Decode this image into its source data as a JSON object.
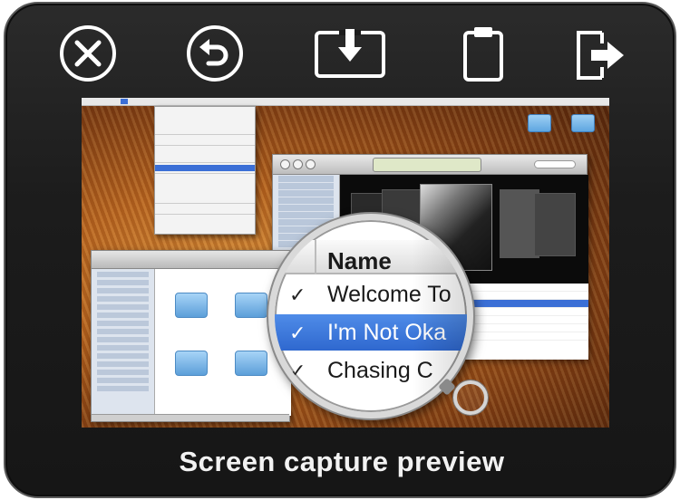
{
  "toolbar": {
    "buttons": [
      {
        "icon": "close-icon"
      },
      {
        "icon": "undo-icon"
      },
      {
        "icon": "save-download-icon"
      },
      {
        "icon": "clipboard-icon"
      },
      {
        "icon": "export-icon"
      }
    ]
  },
  "caption": "Screen capture preview",
  "magnifier": {
    "column_header": "Name",
    "rows": [
      {
        "check": "✓",
        "title": "Welcome To"
      },
      {
        "check": "✓",
        "title": "I'm Not Oka"
      },
      {
        "check": "✓",
        "title": "Chasing C"
      }
    ]
  },
  "colors": {
    "panel": "#1c1c1c",
    "icon_stroke": "#ffffff",
    "selection": "#3b6fd6",
    "caption": "#f2f2f2"
  }
}
